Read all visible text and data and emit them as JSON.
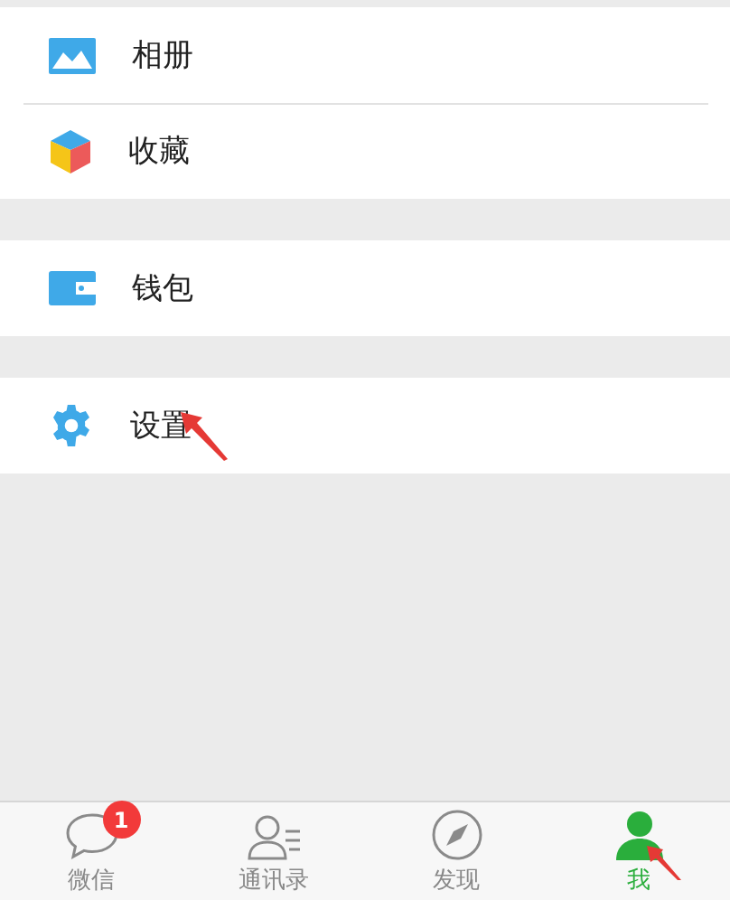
{
  "menu_groups": [
    {
      "items": [
        {
          "kind": "album",
          "label": "相册"
        },
        {
          "kind": "favorites",
          "label": "收藏"
        }
      ]
    },
    {
      "items": [
        {
          "kind": "wallet",
          "label": "钱包"
        }
      ]
    },
    {
      "items": [
        {
          "kind": "settings",
          "label": "设置"
        }
      ]
    }
  ],
  "tab_bar": [
    {
      "kind": "chats",
      "label": "微信",
      "badge": "1",
      "selected": false
    },
    {
      "kind": "contacts",
      "label": "通讯录",
      "selected": false
    },
    {
      "kind": "discover",
      "label": "发现",
      "selected": false
    },
    {
      "kind": "me",
      "label": "我",
      "selected": true
    }
  ]
}
